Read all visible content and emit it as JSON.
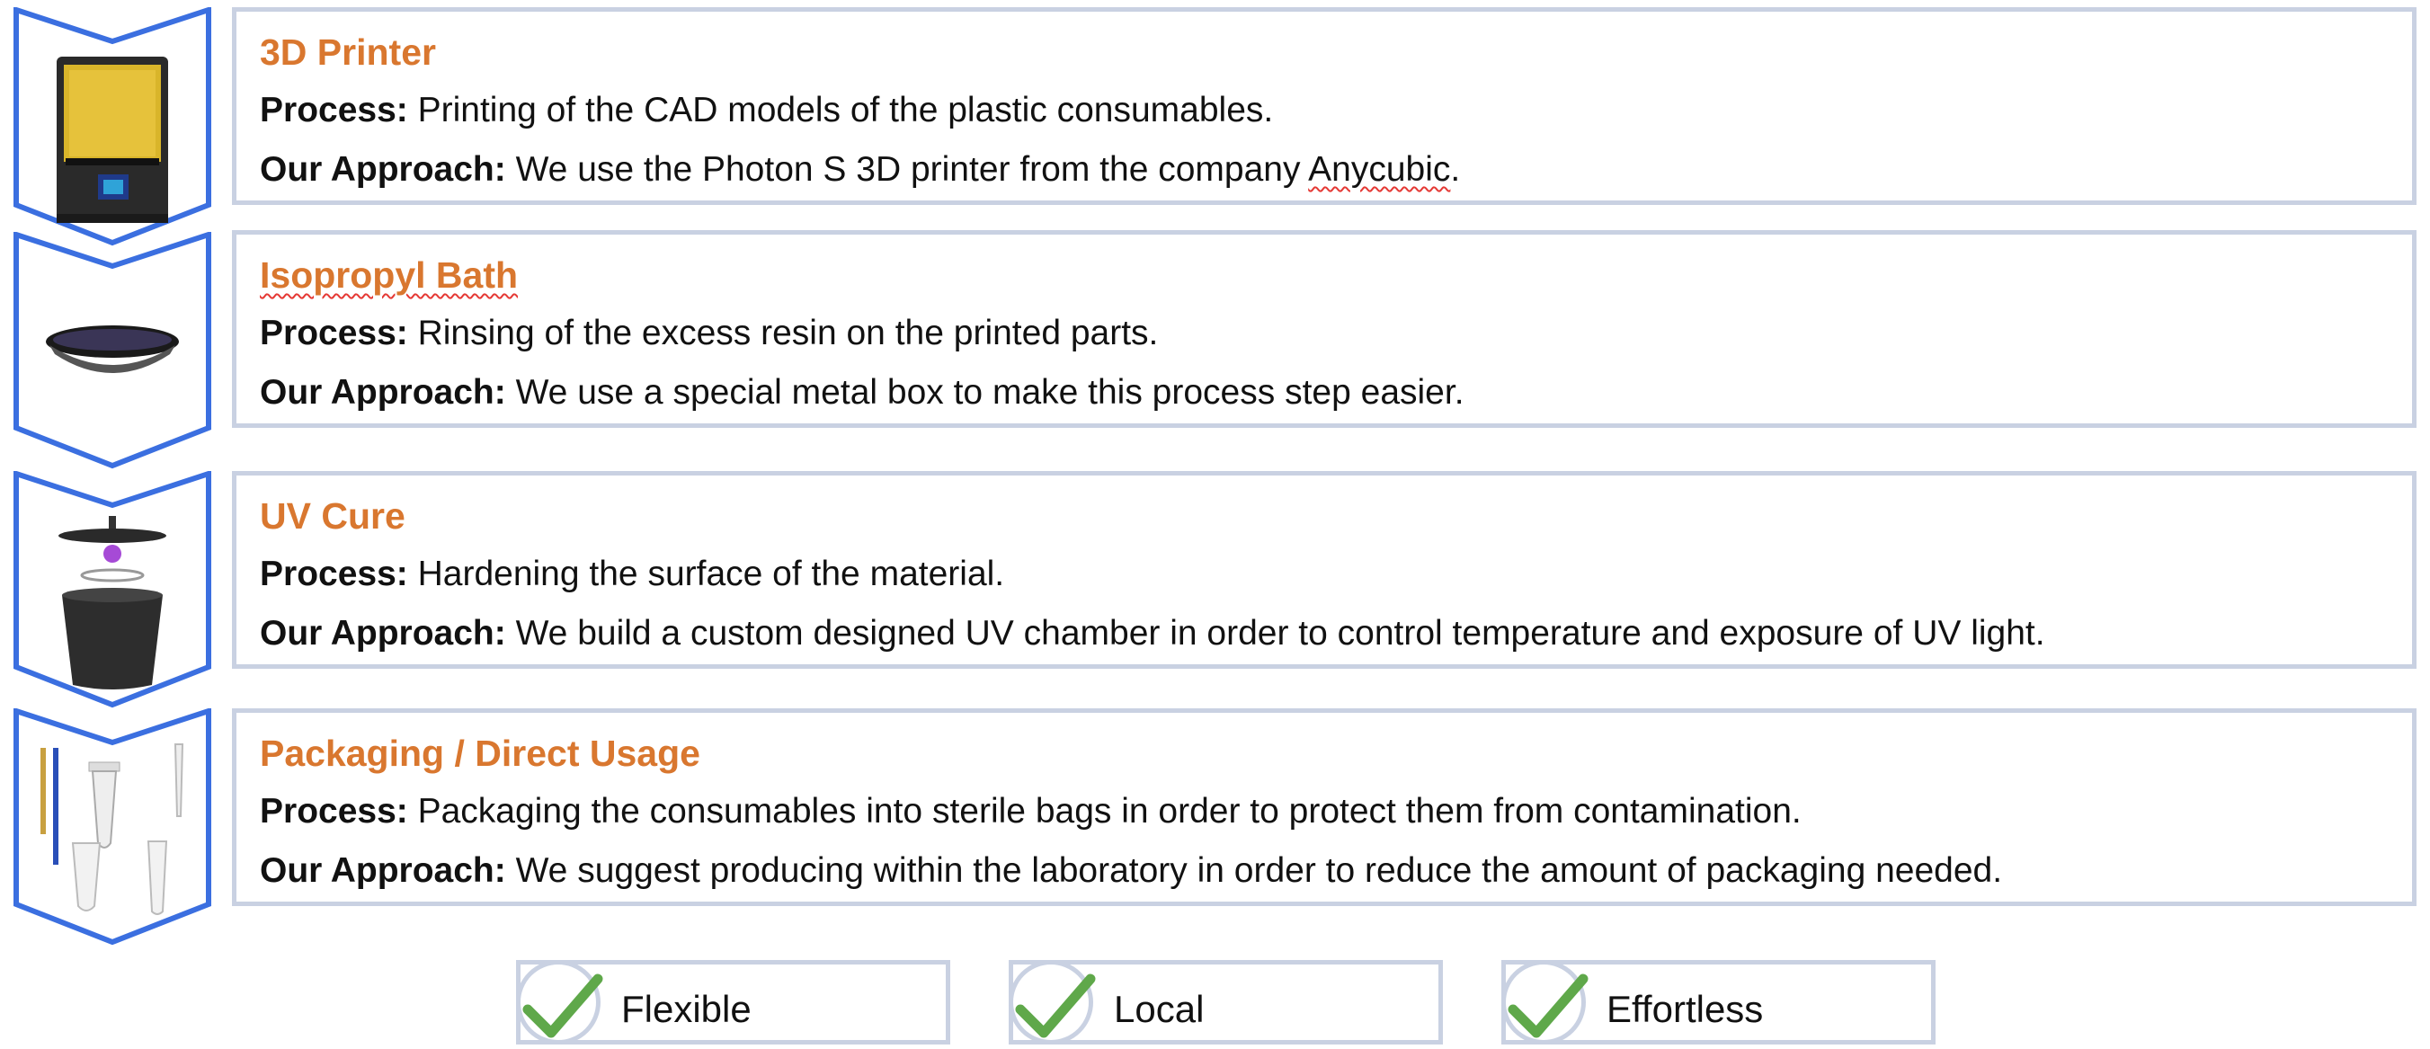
{
  "steps": [
    {
      "title": "3D Printer",
      "process_label": "Process:",
      "process_text": " Printing of the CAD models of the plastic consumables.",
      "approach_label": "Our Approach:",
      "approach_text_before": " We use the Photon S 3D printer from the company ",
      "approach_text_flagged": "Anycubic",
      "approach_text_after": "."
    },
    {
      "title": "Isopropyl Bath",
      "process_label": "Process:",
      "process_text": " Rinsing of the excess resin on the printed parts.",
      "approach_label": "Our Approach:",
      "approach_text": " We use a special metal box to make this process step easier."
    },
    {
      "title": "UV Cure",
      "process_label": "Process:",
      "process_text": " Hardening the surface of the material.",
      "approach_label": "Our Approach:",
      "approach_text": " We build a custom designed UV chamber in order to control temperature and exposure of UV light."
    },
    {
      "title": "Packaging / Direct Usage",
      "process_label": "Process:",
      "process_text": " Packaging the consumables into sterile bags in order to protect them from contamination.",
      "approach_label": "Our Approach:",
      "approach_text": " We suggest producing within the laboratory in order to reduce the amount of packaging needed."
    }
  ],
  "badges": [
    "Flexible",
    "Local",
    "Effortless"
  ],
  "colors": {
    "title": "#d9772f",
    "chevron_border": "#3b6fe0",
    "card_border": "#c9d1e2",
    "check": "#5fa84a"
  },
  "icons": [
    "3d-printer-icon",
    "resin-bath-tray-icon",
    "uv-lamp-chamber-icon",
    "lab-tubes-icon",
    "checkmark-icon"
  ]
}
